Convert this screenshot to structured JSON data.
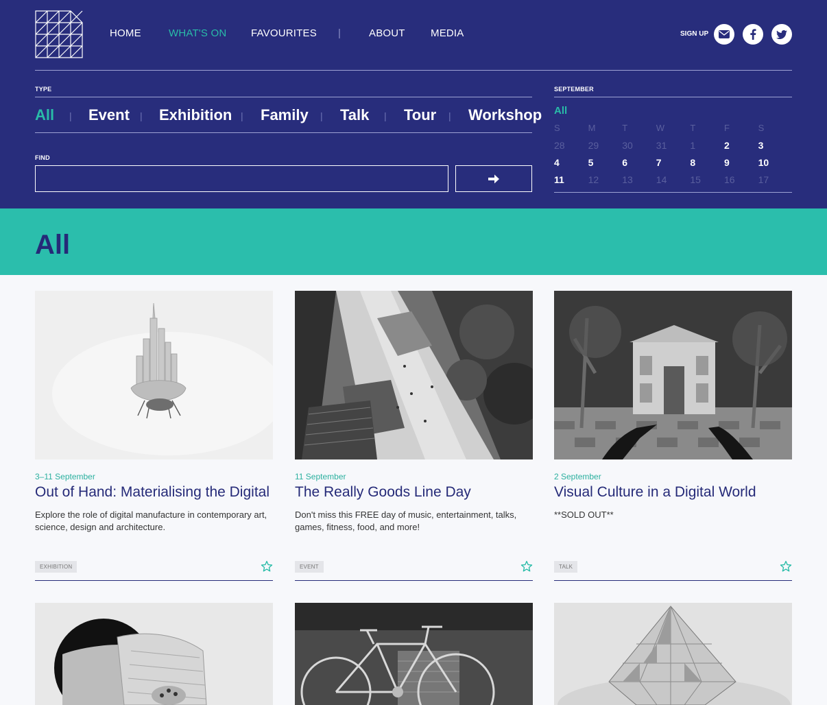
{
  "nav": {
    "home": "HOME",
    "whats_on": "WHAT'S ON",
    "favourites": "FAVOURITES",
    "separator": "|",
    "about": "ABOUT",
    "media": "MEDIA",
    "signup": "SIGN UP"
  },
  "filters": {
    "type_label": "TYPE",
    "sep": "|",
    "types": [
      "All",
      "Event",
      "Exhibition",
      "Family",
      "Talk",
      "Tour",
      "Workshop"
    ],
    "active_type": "All",
    "find_label": "FIND",
    "find_value": "",
    "find_placeholder": ""
  },
  "calendar": {
    "month": "SEPTEMBER",
    "all_label": "All",
    "weekdays": [
      "S",
      "M",
      "T",
      "W",
      "T",
      "F",
      "S"
    ],
    "days": [
      {
        "d": "28",
        "on": false
      },
      {
        "d": "29",
        "on": false
      },
      {
        "d": "30",
        "on": false
      },
      {
        "d": "31",
        "on": false
      },
      {
        "d": "1",
        "on": false
      },
      {
        "d": "2",
        "on": true
      },
      {
        "d": "3",
        "on": true
      },
      {
        "d": "4",
        "on": true
      },
      {
        "d": "5",
        "on": true
      },
      {
        "d": "6",
        "on": true
      },
      {
        "d": "7",
        "on": true
      },
      {
        "d": "8",
        "on": true
      },
      {
        "d": "9",
        "on": true
      },
      {
        "d": "10",
        "on": true
      },
      {
        "d": "11",
        "on": true
      },
      {
        "d": "12",
        "on": false
      },
      {
        "d": "13",
        "on": false
      },
      {
        "d": "14",
        "on": false
      },
      {
        "d": "15",
        "on": false
      },
      {
        "d": "16",
        "on": false
      },
      {
        "d": "17",
        "on": false
      }
    ]
  },
  "banner": {
    "title": "All"
  },
  "cards": [
    {
      "date": "3–11 September",
      "title": "Out of Hand: Materialising the Digital",
      "description": "Explore the role of digital manufacture in contemporary art, science, design and architecture.",
      "tag": "EXHIBITION"
    },
    {
      "date": "11 September",
      "title": "The Really Goods Line Day",
      "description": "Don't miss this FREE day of music, entertainment, talks, games, fitness, food, and more!",
      "tag": "EVENT"
    },
    {
      "date": "2 September",
      "title": "Visual Culture in a Digital World",
      "description": "**SOLD OUT**",
      "tag": "TALK"
    }
  ],
  "colors": {
    "header_bg": "#282d7c",
    "accent": "#29bca8",
    "banner_bg": "#2bbeac",
    "text_dark": "#252a78"
  }
}
